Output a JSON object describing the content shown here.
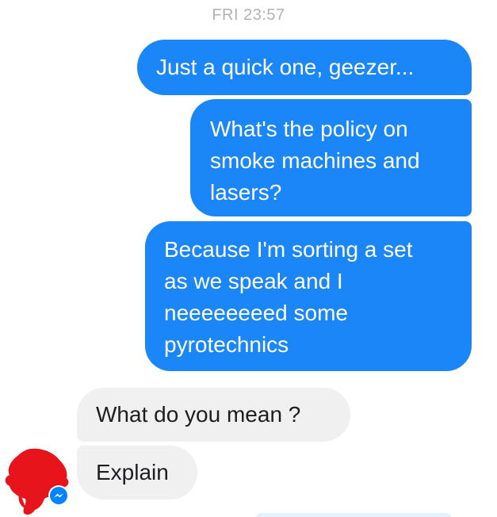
{
  "timestamp": "FRI 23:57",
  "messages": [
    {
      "direction": "outgoing",
      "text": "Just a quick one, geezer..."
    },
    {
      "direction": "outgoing",
      "text": "What's the policy on\nsmoke machines and\nlasers?"
    },
    {
      "direction": "outgoing",
      "text": "Because I'm sorting a set\nas we speak and I\nneeeeeeeed some\npyrotechnics"
    },
    {
      "direction": "incoming",
      "text": "What do you mean ?"
    },
    {
      "direction": "incoming",
      "text": "Explain"
    }
  ],
  "colors": {
    "outgoing_bubble": "#1b86f7",
    "incoming_bubble": "#f0f0f0",
    "timestamp_text": "#b0b3b8",
    "avatar_redaction": "#e8141c",
    "messenger_badge": "#0084ff"
  },
  "icons": {
    "avatar": "redacted-avatar",
    "badge": "messenger-icon"
  }
}
